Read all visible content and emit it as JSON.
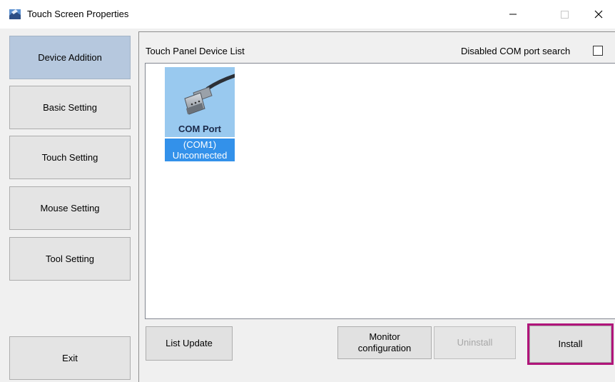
{
  "window": {
    "title": "Touch Screen Properties",
    "controls": {
      "minimize": "—",
      "maximize": "☐",
      "close": "✕"
    }
  },
  "sidebar": {
    "items": [
      {
        "label": "Device Addition",
        "active": true
      },
      {
        "label": "Basic Setting",
        "active": false
      },
      {
        "label": "Touch Setting",
        "active": false
      },
      {
        "label": "Mouse Setting",
        "active": false
      },
      {
        "label": "Tool Setting",
        "active": false
      }
    ],
    "exit_label": "Exit"
  },
  "main": {
    "list_label": "Touch Panel Device List",
    "com_search_label": "Disabled COM port search",
    "com_search_checked": false,
    "devices": [
      {
        "name": "COM Port",
        "port": "(COM1)",
        "status": "Unconnected",
        "selected": true,
        "icon": "serial-cable-icon"
      }
    ]
  },
  "buttons": {
    "list_update": "List Update",
    "monitor_config": "Monitor configuration",
    "uninstall": "Uninstall",
    "install": "Install"
  },
  "colors": {
    "highlight": "#b0157a",
    "selection": "#3391ea",
    "active_nav": "#b6c8de"
  }
}
